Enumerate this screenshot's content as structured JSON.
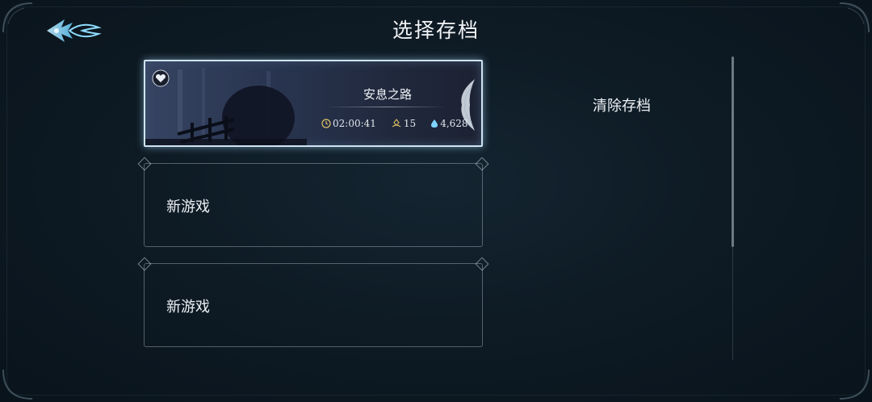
{
  "header": {
    "title": "选择存档",
    "back_icon": "winged-back-icon"
  },
  "save_slots": [
    {
      "type": "saved",
      "location": "安息之路",
      "play_time": "02:00:41",
      "level": "15",
      "currency": "4,628",
      "icons": {
        "emblem": "heart-gem-icon",
        "time": "clock-icon",
        "level": "level-icon",
        "currency": "droplet-icon"
      }
    },
    {
      "type": "empty",
      "label": "新游戏"
    },
    {
      "type": "empty",
      "label": "新游戏"
    }
  ],
  "actions": {
    "delete_save": "清除存档"
  },
  "colors": {
    "background": "#0b1620",
    "highlight_glow": "#cfe4f2",
    "accent_blue": "#7fd4ff"
  }
}
